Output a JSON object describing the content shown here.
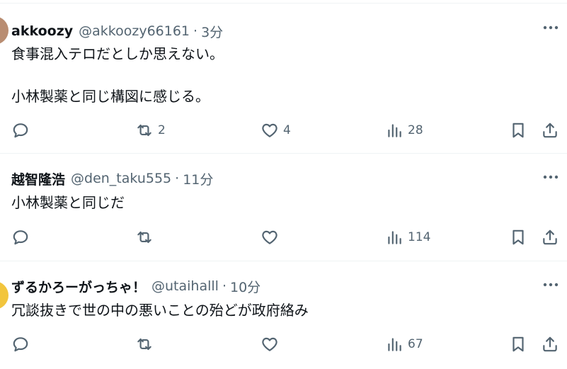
{
  "tweets": [
    {
      "name": "akkoozy",
      "handle": "@akkoozy66161",
      "sep": "·",
      "time": "3分",
      "text": "食事混入テロだとしか思えない。\n\n小林製薬と同じ構図に感じる。",
      "replies": "",
      "retweets": "2",
      "likes": "4",
      "views": "28",
      "avatar_color": "#b98d72"
    },
    {
      "name": "越智隆浩",
      "handle": "@den_taku555",
      "sep": "·",
      "time": "11分",
      "text": "小林製薬と同じだ",
      "replies": "",
      "retweets": "",
      "likes": "",
      "views": "114",
      "avatar_color": "#ffffff"
    },
    {
      "name": "ずるかろーがっちゃ！",
      "handle": "@utaihalll",
      "sep": "·",
      "time": "10分",
      "text": "冗談抜きで世の中の悪いことの殆どが政府絡み",
      "replies": "",
      "retweets": "",
      "likes": "",
      "views": "67",
      "avatar_color": "#f2c53d"
    }
  ],
  "icons": {
    "more": "more-dots-icon",
    "reply": "reply-bubble-icon",
    "retweet": "retweet-icon",
    "like": "heart-icon",
    "views": "bar-chart-icon",
    "bookmark": "bookmark-icon",
    "share": "share-upload-icon"
  },
  "colors": {
    "text": "#0f1419",
    "secondary": "#536471",
    "divider": "#eff3f4"
  }
}
